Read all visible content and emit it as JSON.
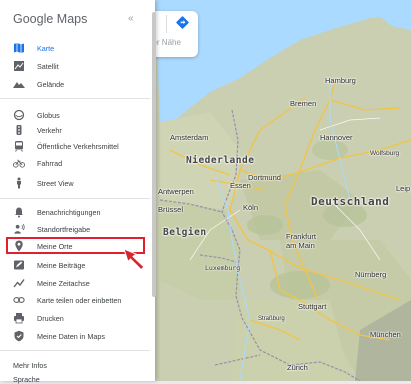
{
  "app": {
    "logo_text": "Google Maps",
    "collapse_glyph": "«",
    "search_hint": "der Nähe"
  },
  "menu": {
    "map_types": [
      {
        "label": "Karte",
        "icon": "map-icon",
        "active": true
      },
      {
        "label": "Satellit",
        "icon": "satellite-icon",
        "active": false
      },
      {
        "label": "Gelände",
        "icon": "terrain-icon",
        "active": false
      }
    ],
    "layers": [
      {
        "label": "Globus",
        "icon": "globe-icon"
      },
      {
        "label": "Verkehr",
        "icon": "traffic-icon"
      },
      {
        "label": "Öffentliche Verkehrsmittel",
        "icon": "transit-icon"
      },
      {
        "label": "Fahrrad",
        "icon": "bicycle-icon"
      },
      {
        "label": "Street View",
        "icon": "pegman-icon"
      }
    ],
    "personal": [
      {
        "label": "Benachrichtigungen",
        "icon": "bell-icon"
      },
      {
        "label": "Standortfreigabe",
        "icon": "location-sharing-icon"
      },
      {
        "label": "Meine Orte",
        "icon": "place-pin-icon",
        "highlighted": true
      },
      {
        "label": "Meine Beiträge",
        "icon": "contributions-icon"
      },
      {
        "label": "Meine Zeitachse",
        "icon": "timeline-icon"
      },
      {
        "label": "Karte teilen oder einbetten",
        "icon": "link-icon"
      },
      {
        "label": "Drucken",
        "icon": "print-icon"
      },
      {
        "label": "Meine Daten in Maps",
        "icon": "shield-icon"
      }
    ],
    "footer": [
      "Mehr Infos",
      "Sprache"
    ]
  },
  "map": {
    "countries": [
      "Deutschland",
      "Niederlande",
      "Belgien"
    ],
    "regions": [
      "Luxemburg"
    ],
    "cities": [
      "Hamburg",
      "Bremen",
      "Amsterdam",
      "Hannover",
      "Wolfsburg",
      "Dortmund",
      "Essen",
      "Leip",
      "Antwerpen",
      "Brüssel",
      "Köln",
      "Frankfurt am Main",
      "Nürnberg",
      "Stuttgart",
      "Straßburg",
      "München",
      "Zürich"
    ]
  },
  "colors": {
    "accent": "#1a73e8",
    "highlight_border": "#e0202e",
    "pointer": "#d9242e"
  }
}
